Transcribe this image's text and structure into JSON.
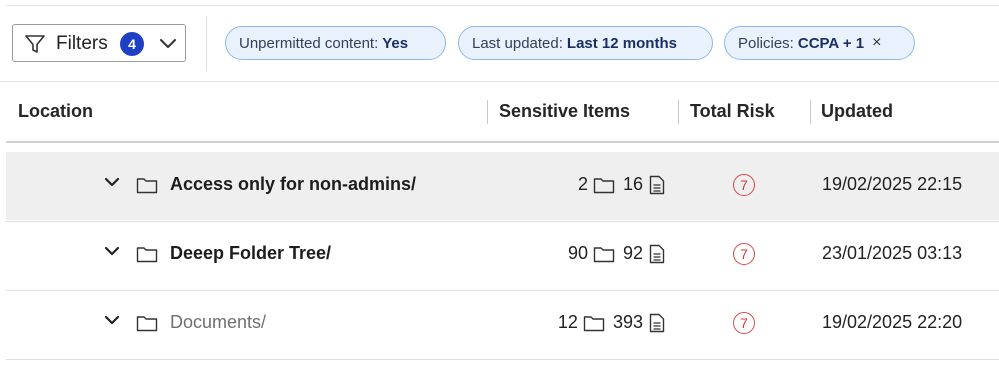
{
  "filters": {
    "label": "Filters",
    "count": "4"
  },
  "chips": [
    {
      "key": "Unpermitted content:",
      "value": "Yes"
    },
    {
      "key": "Last updated:",
      "value": "Last 12 months"
    },
    {
      "key": "Policies:",
      "value": "CCPA + 1",
      "close": "×"
    }
  ],
  "table": {
    "headers": {
      "location": "Location",
      "sensitive": "Sensitive Items",
      "risk": "Total Risk",
      "updated": "Updated"
    },
    "rows": [
      {
        "name": "Access only for non-admins/",
        "folders": "2",
        "files": "16",
        "risk": "7",
        "updated": "19/02/2025 22:15",
        "style": "bold"
      },
      {
        "name": "Deeep Folder Tree/",
        "folders": "90",
        "files": "92",
        "risk": "7",
        "updated": "23/01/2025 03:13",
        "style": "bold"
      },
      {
        "name": "Documents/",
        "folders": "12",
        "files": "393",
        "risk": "7",
        "updated": "19/02/2025 22:20",
        "style": "muted"
      }
    ]
  },
  "colors": {
    "accent": "#1f3fc4",
    "chip_bg": "#e9f2fc",
    "chip_border": "#8fb8e8",
    "risk": "#d84a4a",
    "selected_row": "#efefef"
  }
}
